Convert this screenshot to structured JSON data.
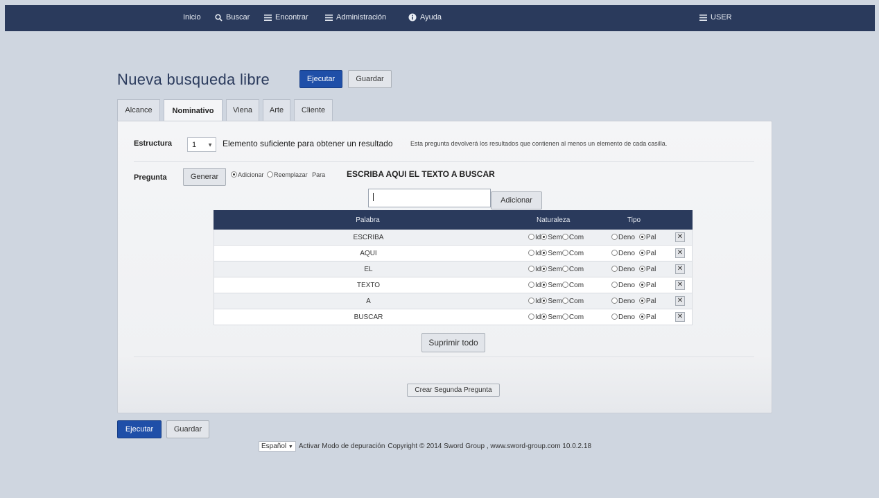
{
  "nav": {
    "inicio": "Inicio",
    "buscar": "Buscar",
    "encontrar": "Encontrar",
    "administracion": "Administración",
    "ayuda": "Ayuda",
    "user": "USER"
  },
  "page": {
    "title": "Nueva busqueda libre",
    "ejecutar": "Ejecutar",
    "guardar": "Guardar"
  },
  "tabs": [
    "Alcance",
    "Nominativo",
    "Viena",
    "Arte",
    "Cliente"
  ],
  "estructura": {
    "label": "Estructura",
    "value": "1",
    "description": "Elemento suficiente para obtener un resultado",
    "note": "Esta pregunta devolverá los resultados que contienen al menos un elemento de cada casilla."
  },
  "pregunta": {
    "label": "Pregunta",
    "generar": "Generar",
    "adicionar_opt": "Adicionar",
    "reemplazar_opt": "Reemplazar",
    "para": "Para",
    "query": "ESCRIBA AQUI EL TEXTO A BUSCAR",
    "input_value": "",
    "adicionar_btn": "Adicionar"
  },
  "table": {
    "headers": {
      "palabra": "Palabra",
      "naturaleza": "Naturaleza",
      "tipo": "Tipo"
    },
    "option_labels": {
      "id": "Id",
      "sem": "Sem",
      "com": "Com",
      "deno": "Deno",
      "pal": "Pal"
    },
    "rows": [
      {
        "word": "ESCRIBA",
        "naturaleza": "Sem",
        "tipo": "Pal"
      },
      {
        "word": "AQUI",
        "naturaleza": "Sem",
        "tipo": "Pal"
      },
      {
        "word": "EL",
        "naturaleza": "Sem",
        "tipo": "Pal"
      },
      {
        "word": "TEXTO",
        "naturaleza": "Sem",
        "tipo": "Pal"
      },
      {
        "word": "A",
        "naturaleza": "Sem",
        "tipo": "Pal"
      },
      {
        "word": "BUSCAR",
        "naturaleza": "Sem",
        "tipo": "Pal"
      }
    ],
    "suprimir": "Suprimir todo"
  },
  "crear_segunda": "Crear Segunda Pregunta",
  "bottom": {
    "ejecutar": "Ejecutar",
    "guardar": "Guardar"
  },
  "footer": {
    "language": "Español",
    "debug": "Activar Modo de depuración",
    "copyright": "Copyright © 2014 Sword Group , www.sword-group.com 10.0.2.18"
  }
}
